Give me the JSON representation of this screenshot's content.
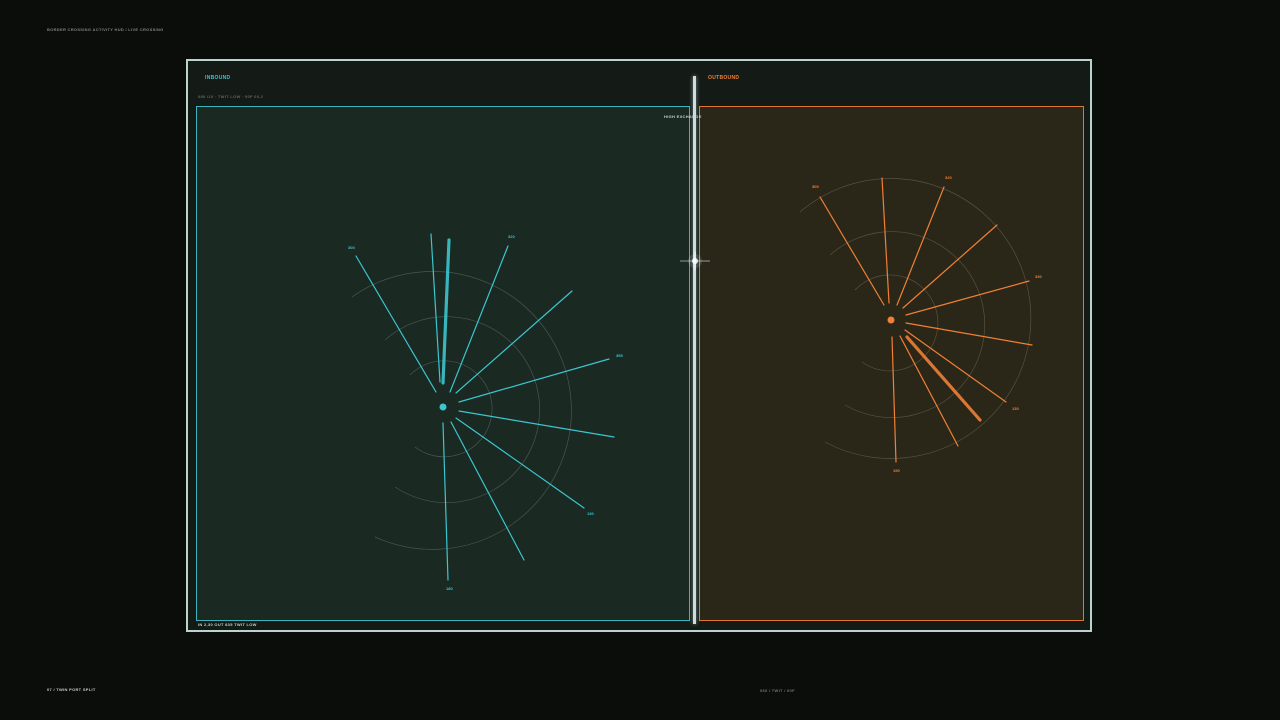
{
  "header": {
    "title": "BORDER CROSSING ACTIVITY HUD  /  LIVE CROSSING"
  },
  "footer": {
    "left": "07 / TWIN PORT SPLIT",
    "center": "060 / TWIT / 00F"
  },
  "colors": {
    "inbound": "#3cc6cf",
    "outbound": "#f08036",
    "background": "#0b0d0a"
  },
  "inbound": {
    "label": "INBOUND",
    "meta": "080 /10 · TWIT LOW · 00F 00.2",
    "tag": "HIGH EXCHANGE",
    "status": "IN  2,30   OUT 835   TWIT LOW",
    "spoke_labels": [
      "300",
      "320",
      "355",
      "130",
      "180"
    ]
  },
  "outbound": {
    "label": "OUTBOUND",
    "spoke_labels": [
      "300",
      "320",
      "330",
      "130",
      "190"
    ]
  }
}
